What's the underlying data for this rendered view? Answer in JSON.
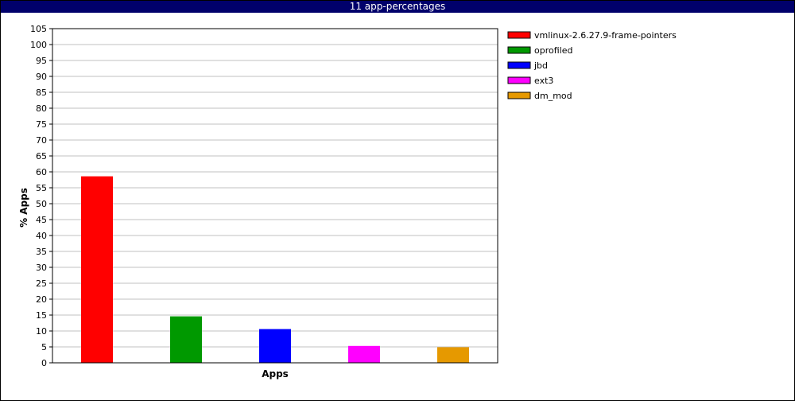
{
  "title": "11 app-percentages",
  "chart_data": {
    "type": "bar",
    "xlabel": "Apps",
    "ylabel": "% Apps",
    "ylim": [
      0,
      105
    ],
    "ytick_step": 5,
    "grid": true,
    "legend_position": "right",
    "categories": [
      "vmlinux-2.6.27.9-frame-pointers",
      "oprofiled",
      "jbd",
      "ext3",
      "dm_mod"
    ],
    "values": [
      58.6,
      14.6,
      10.6,
      5.3,
      4.9
    ],
    "colors": [
      "#ff0000",
      "#009900",
      "#0000ff",
      "#ff00ff",
      "#e69900"
    ]
  }
}
